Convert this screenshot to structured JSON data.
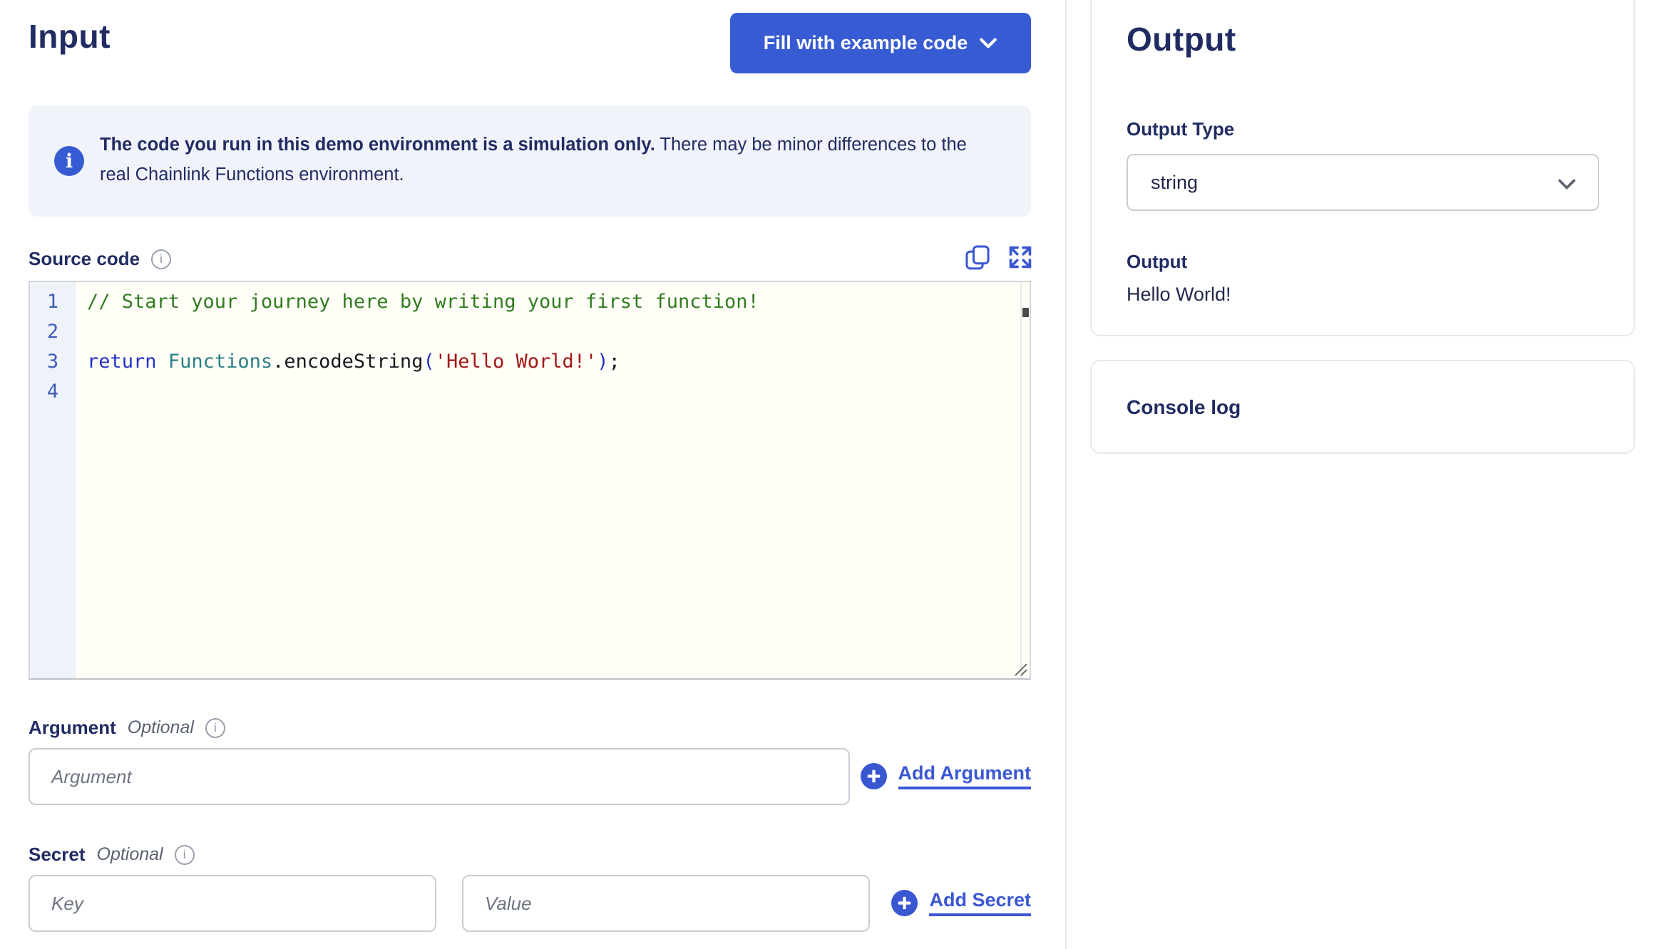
{
  "input_panel": {
    "title": "Input",
    "fill_button_label": "Fill with example code",
    "notice": {
      "bold": "The code you run in this demo environment is a simulation only.",
      "regular": " There may be minor differences to the real Chainlink Functions environment."
    },
    "source_code_label": "Source code",
    "editor": {
      "lines": [
        {
          "num": "1",
          "tokens": [
            {
              "text": "// Start your journey here by writing your first function!",
              "type": "comment"
            }
          ]
        },
        {
          "num": "2",
          "tokens": []
        },
        {
          "num": "3",
          "tokens": [
            {
              "text": "return",
              "type": "keyword"
            },
            {
              "text": " ",
              "type": "plain"
            },
            {
              "text": "Functions",
              "type": "type"
            },
            {
              "text": ".encodeString",
              "type": "plain"
            },
            {
              "text": "(",
              "type": "paren"
            },
            {
              "text": "'Hello World!'",
              "type": "string"
            },
            {
              "text": ")",
              "type": "paren"
            },
            {
              "text": ";",
              "type": "plain"
            }
          ]
        },
        {
          "num": "4",
          "tokens": []
        }
      ]
    },
    "argument": {
      "label": "Argument",
      "optional": "Optional",
      "placeholder": "Argument",
      "value": "",
      "add_label": "Add Argument"
    },
    "secret": {
      "label": "Secret",
      "optional": "Optional",
      "key_placeholder": "Key",
      "key_value": "",
      "value_placeholder": "Value",
      "value_value": "",
      "add_label": "Add Secret"
    },
    "info_glyph": "i"
  },
  "output_panel": {
    "title": "Output",
    "output_type_label": "Output Type",
    "output_type_selected": "string",
    "output_label": "Output",
    "output_value": "Hello World!",
    "console_label": "Console log"
  },
  "colors": {
    "accent_blue": "#375bd2",
    "link_blue": "#3a57d2",
    "navy_text": "#212c63",
    "notice_background": "#f1f3fa",
    "gutter_background": "#eef2f9",
    "line_number": "#3e5cb5",
    "code_comment": "#317c20",
    "code_keyword": "#2230c9",
    "code_type": "#2c7e85",
    "code_string": "#a31515",
    "editor_background": "#fffef7"
  }
}
